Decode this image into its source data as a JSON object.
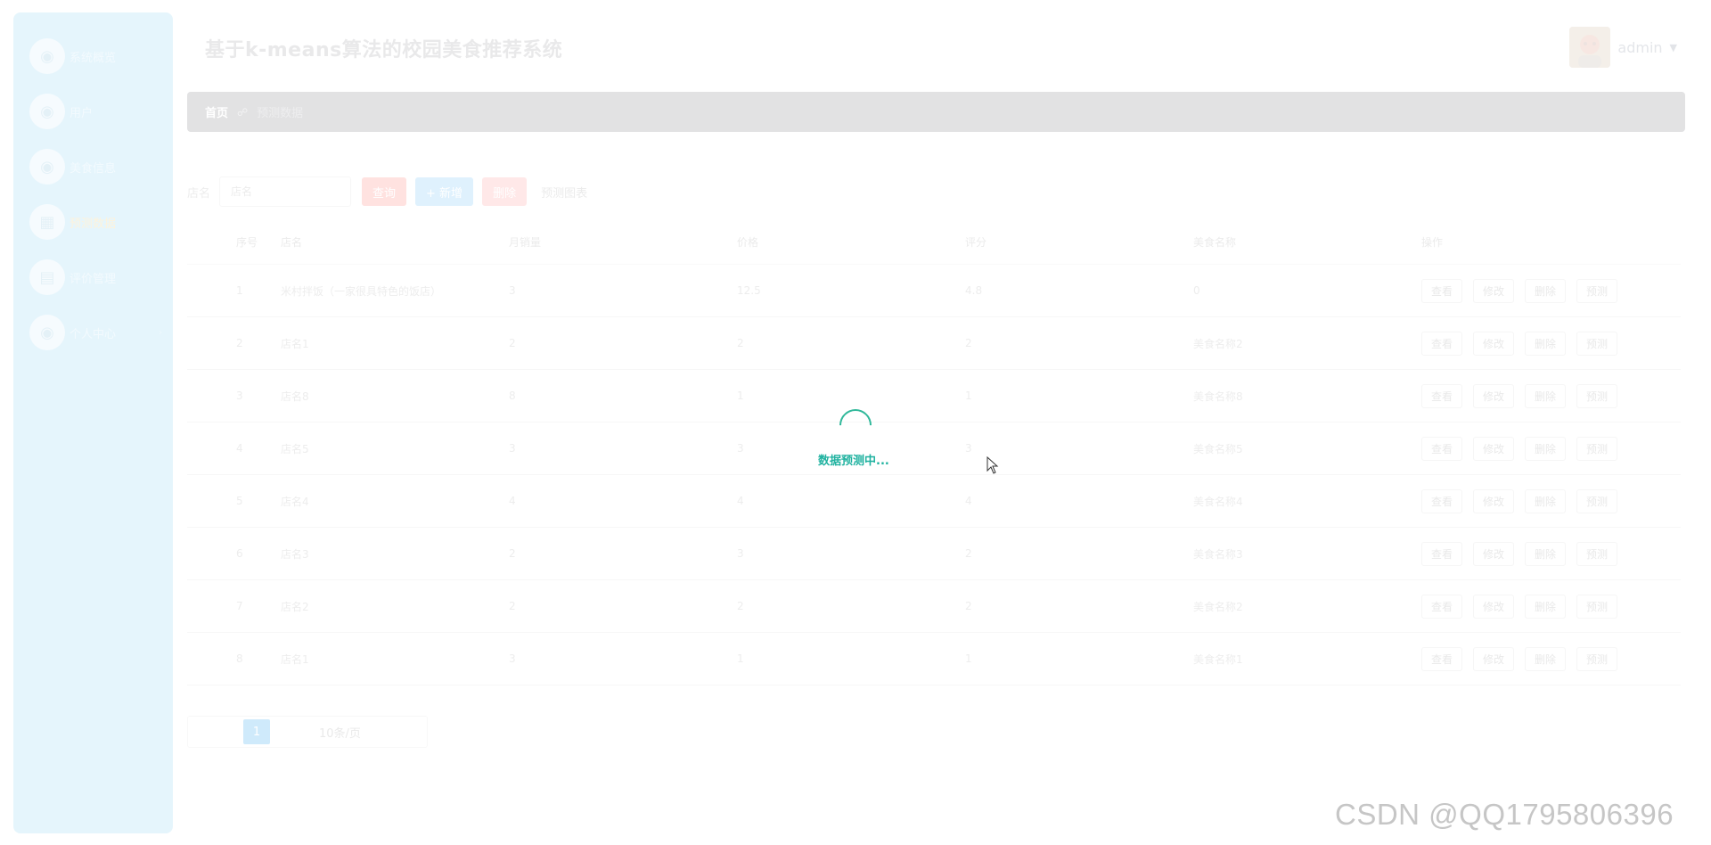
{
  "sidebar": {
    "items": [
      {
        "label": "系统概览",
        "icon": "dashboard-icon"
      },
      {
        "label": "用户",
        "icon": "user-icon"
      },
      {
        "label": "美食信息",
        "icon": "food-icon"
      },
      {
        "label": "预测数据",
        "icon": "chart-icon",
        "active": true
      },
      {
        "label": "评价管理",
        "icon": "comment-icon"
      },
      {
        "label": "个人中心",
        "icon": "profile-icon"
      }
    ]
  },
  "header": {
    "title": "基于k-means算法的校园美食推荐系统",
    "username": "admin"
  },
  "breadcrumb": {
    "home": "首页",
    "separator": "☍",
    "current": "预测数据"
  },
  "search": {
    "label": "店名",
    "placeholder": "店名",
    "search_btn": "查询",
    "add_btn": "+ 新增",
    "delete_btn": "删除",
    "chart_btn": "预测图表"
  },
  "table": {
    "headers": [
      "序号",
      "店名",
      "月销量",
      "价格",
      "评分",
      "美食名称",
      "操作"
    ],
    "rows": [
      {
        "idx": "1",
        "name": "米村拌饭（一家很具特色的饭店）",
        "sales": "3",
        "price": "12.5",
        "score": "4.8",
        "food": "0"
      },
      {
        "idx": "2",
        "name": "店名1",
        "sales": "2",
        "price": "2",
        "score": "2",
        "food": "美食名称2"
      },
      {
        "idx": "3",
        "name": "店名8",
        "sales": "8",
        "price": "1",
        "score": "1",
        "food": "美食名称8"
      },
      {
        "idx": "4",
        "name": "店名5",
        "sales": "3",
        "price": "3",
        "score": "3",
        "food": "美食名称5"
      },
      {
        "idx": "5",
        "name": "店名4",
        "sales": "4",
        "price": "4",
        "score": "4",
        "food": "美食名称4"
      },
      {
        "idx": "6",
        "name": "店名3",
        "sales": "2",
        "price": "3",
        "score": "2",
        "food": "美食名称3"
      },
      {
        "idx": "7",
        "name": "店名2",
        "sales": "2",
        "price": "2",
        "score": "2",
        "food": "美食名称2"
      },
      {
        "idx": "8",
        "name": "店名1",
        "sales": "3",
        "price": "1",
        "score": "1",
        "food": "美食名称1"
      }
    ],
    "ops": [
      "查看",
      "修改",
      "删除",
      "预测"
    ]
  },
  "pagination": {
    "current_page": "1",
    "page_size": "10条/页"
  },
  "loading": {
    "text": "数据预测中..."
  },
  "watermark": "CSDN @QQ1795806396",
  "colors": {
    "spinner": "#30b89a",
    "loading_text": "#20b2a0",
    "sidebar_bg": "#e5f5fc"
  }
}
